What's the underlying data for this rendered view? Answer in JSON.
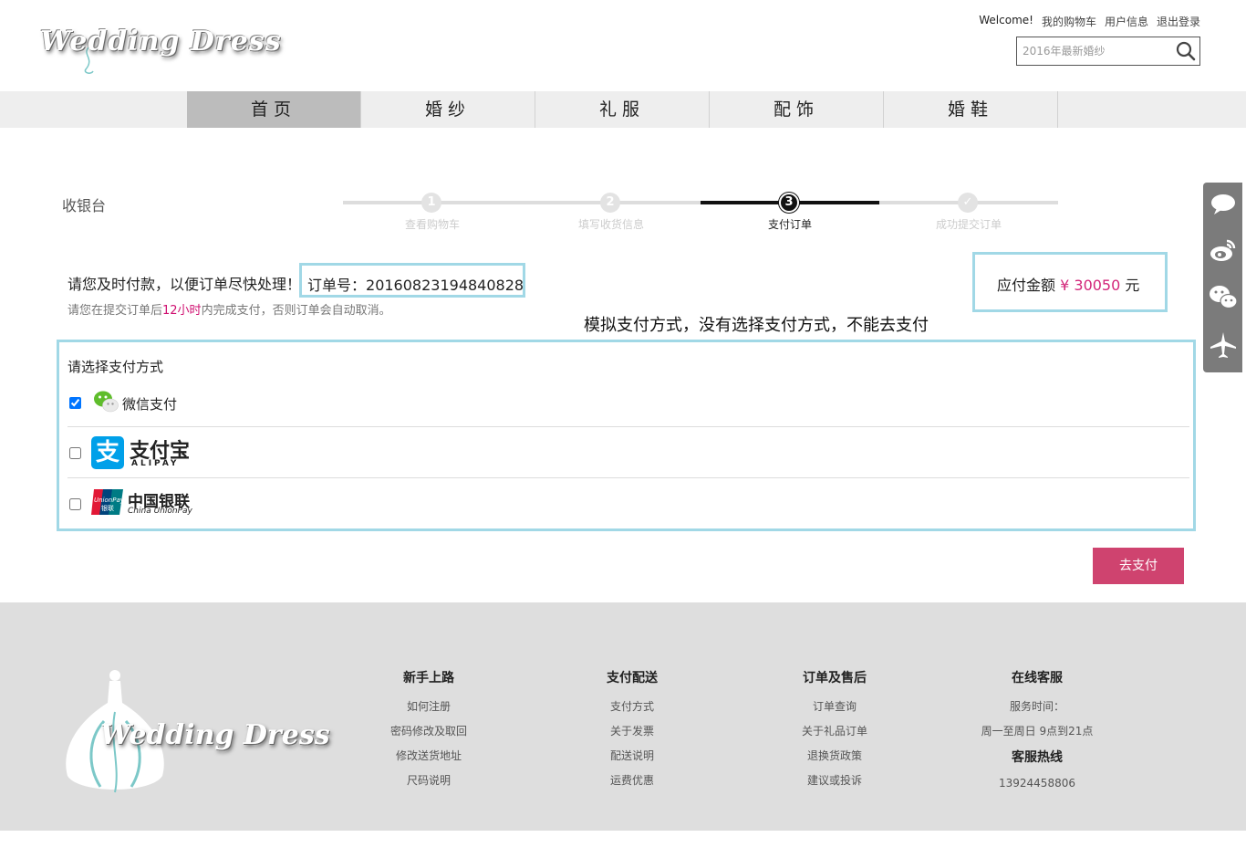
{
  "header": {
    "logo_text": "Wedding Dress",
    "welcome": "Welcome!",
    "links": [
      "我的购物车",
      "用户信息",
      "退出登录"
    ],
    "search_placeholder": "2016年最新婚纱"
  },
  "nav": {
    "items": [
      "首页",
      "婚纱",
      "礼服",
      "配饰",
      "婚鞋"
    ],
    "active": "首页"
  },
  "checkout": {
    "title": "收银台",
    "steps": [
      {
        "num": "1",
        "label": "查看购物车"
      },
      {
        "num": "2",
        "label": "填写收货信息"
      },
      {
        "num": "3",
        "label": "支付订单"
      },
      {
        "num": "✓",
        "label": "成功提交订单"
      }
    ],
    "active_step": 3,
    "notice": "请您及时付款，以便订单尽快处理！",
    "order_label": "订单号：",
    "order_number": "20160823194840828",
    "sub_notice_pre": "请您在提交订单后",
    "sub_notice_hl": "12小时",
    "sub_notice_post": "内完成支付，否则订单会自动取消。",
    "amount_label": "应付金额",
    "currency": "¥",
    "amount": "30050",
    "amount_unit": "元",
    "annotation": "模拟支付方式，没有选择支付方式，不能去支付"
  },
  "payment": {
    "title": "请选择支付方式",
    "wechat_label": "微信支付",
    "wechat_checked": true,
    "alipay_cn": "支付宝",
    "alipay_en": "ALIPAY",
    "alipay_checked": false,
    "unionpay_cn": "中国银联",
    "unionpay_en": "China UnionPay",
    "unionpay_checked": false,
    "submit_label": "去支付"
  },
  "sidebar": {
    "icons": [
      "chat-bubble-icon",
      "weibo-icon",
      "wechat-icon",
      "airplane-icon"
    ]
  },
  "footer": {
    "logo_text": "Wedding Dress",
    "columns": [
      {
        "title": "新手上路",
        "items": [
          "如何注册",
          "密码修改及取回",
          "修改送货地址",
          "尺码说明"
        ]
      },
      {
        "title": "支付配送",
        "items": [
          "支付方式",
          "关于发票",
          "配送说明",
          "运费优惠"
        ]
      },
      {
        "title": "订单及售后",
        "items": [
          "订单查询",
          "关于礼品订单",
          "退换货政策",
          "建议或投诉"
        ]
      }
    ],
    "service": {
      "title": "在线客服",
      "time_label": "服务时间：",
      "time": "周一至周日 9点到21点",
      "hotline_title": "客服热线",
      "hotline": "13924458806"
    }
  },
  "colors": {
    "accent": "#cf436f",
    "highlight_border": "#a1d8e6",
    "price": "#d3267a"
  }
}
